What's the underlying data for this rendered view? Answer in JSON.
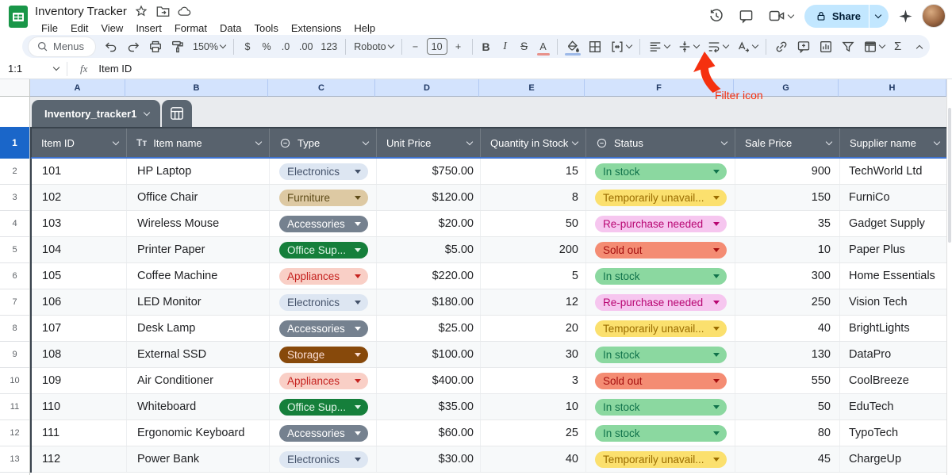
{
  "app": {
    "title": "Inventory Tracker",
    "menus": [
      "File",
      "Edit",
      "View",
      "Insert",
      "Format",
      "Data",
      "Tools",
      "Extensions",
      "Help"
    ],
    "share_label": "Share"
  },
  "toolbar": {
    "menus_label": "Menus",
    "items": [
      {
        "t": "icon",
        "name": "undo"
      },
      {
        "t": "icon",
        "name": "redo"
      },
      {
        "t": "icon",
        "name": "print"
      },
      {
        "t": "icon",
        "name": "paint-format"
      },
      {
        "t": "textchev",
        "name": "zoom",
        "label": "150%"
      },
      {
        "t": "div"
      },
      {
        "t": "text",
        "name": "format-currency",
        "label": "$"
      },
      {
        "t": "text",
        "name": "format-percent",
        "label": "%"
      },
      {
        "t": "text",
        "name": "decrease-decimal",
        "label": ".0"
      },
      {
        "t": "text",
        "name": "increase-decimal",
        "label": ".00"
      },
      {
        "t": "text",
        "name": "number-format",
        "label": "123"
      },
      {
        "t": "div"
      },
      {
        "t": "textchev",
        "name": "font-family",
        "label": "Roboto"
      },
      {
        "t": "div"
      },
      {
        "t": "text",
        "name": "decrease-font-size",
        "label": "−"
      },
      {
        "t": "box",
        "name": "font-size",
        "label": "10"
      },
      {
        "t": "text",
        "name": "increase-font-size",
        "label": "+"
      },
      {
        "t": "div"
      },
      {
        "t": "text",
        "name": "bold",
        "label": "B",
        "cls": "bold"
      },
      {
        "t": "text",
        "name": "italic",
        "label": "I",
        "cls": "ital"
      },
      {
        "t": "text",
        "name": "strikethrough",
        "label": "S",
        "cls": "strike"
      },
      {
        "t": "text",
        "name": "text-color",
        "label": "A",
        "bar": "#e8918a"
      },
      {
        "t": "div"
      },
      {
        "t": "icon",
        "name": "fill-color",
        "bar": "#9db9e8"
      },
      {
        "t": "icon",
        "name": "borders"
      },
      {
        "t": "iconchev",
        "name": "merge-cells"
      },
      {
        "t": "div"
      },
      {
        "t": "iconchev",
        "name": "horizontal-align"
      },
      {
        "t": "iconchev",
        "name": "vertical-align"
      },
      {
        "t": "iconchev",
        "name": "text-wrap"
      },
      {
        "t": "iconchev",
        "name": "text-rotation"
      },
      {
        "t": "div"
      },
      {
        "t": "icon",
        "name": "insert-link"
      },
      {
        "t": "icon",
        "name": "insert-comment"
      },
      {
        "t": "icon",
        "name": "insert-chart"
      },
      {
        "t": "icon",
        "name": "create-filter"
      },
      {
        "t": "iconchev",
        "name": "table-views"
      },
      {
        "t": "text",
        "name": "functions",
        "label": "Σ",
        "cls": "sigma"
      }
    ]
  },
  "formula_bar": {
    "name_box": "1:1",
    "fx_label": "fx",
    "value": "Item ID"
  },
  "columns": [
    "A",
    "B",
    "C",
    "D",
    "E",
    "F",
    "G",
    "H"
  ],
  "sheet_tab": {
    "name": "Inventory_tracker1"
  },
  "table": {
    "headers": [
      {
        "label": "Item ID",
        "icon": null
      },
      {
        "label": "Item name",
        "icon": "text"
      },
      {
        "label": "Type",
        "icon": "chip"
      },
      {
        "label": "Unit Price",
        "icon": null
      },
      {
        "label": "Quantity in Stock",
        "icon": null
      },
      {
        "label": "Status",
        "icon": "chip"
      },
      {
        "label": "Sale Price",
        "icon": null
      },
      {
        "label": "Supplier name",
        "icon": null
      }
    ],
    "rows": [
      {
        "n": "2",
        "id": "101",
        "name": "HP Laptop",
        "type": {
          "label": "Electronics",
          "style": "electronics"
        },
        "unit_price": "$750.00",
        "qty": "15",
        "status": {
          "label": "In stock",
          "style": "instock"
        },
        "sale_price": "900",
        "supplier": "TechWorld Ltd"
      },
      {
        "n": "3",
        "id": "102",
        "name": "Office Chair",
        "type": {
          "label": "Furniture",
          "style": "furniture"
        },
        "unit_price": "$120.00",
        "qty": "8",
        "status": {
          "label": "Temporarily unavail...",
          "style": "unavailable"
        },
        "sale_price": "150",
        "supplier": "FurniCo"
      },
      {
        "n": "4",
        "id": "103",
        "name": "Wireless Mouse",
        "type": {
          "label": "Accessories",
          "style": "accessories"
        },
        "unit_price": "$20.00",
        "qty": "50",
        "status": {
          "label": "Re-purchase needed",
          "style": "repurchase"
        },
        "sale_price": "35",
        "supplier": "Gadget Supply"
      },
      {
        "n": "5",
        "id": "104",
        "name": "Printer Paper",
        "type": {
          "label": "Office Sup...",
          "style": "office"
        },
        "unit_price": "$5.00",
        "qty": "200",
        "status": {
          "label": "Sold out",
          "style": "soldout"
        },
        "sale_price": "10",
        "supplier": "Paper Plus"
      },
      {
        "n": "6",
        "id": "105",
        "name": "Coffee Machine",
        "type": {
          "label": "Appliances",
          "style": "appliances"
        },
        "unit_price": "$220.00",
        "qty": "5",
        "status": {
          "label": "In stock",
          "style": "instock"
        },
        "sale_price": "300",
        "supplier": "Home Essentials"
      },
      {
        "n": "7",
        "id": "106",
        "name": "LED Monitor",
        "type": {
          "label": "Electronics",
          "style": "electronics"
        },
        "unit_price": "$180.00",
        "qty": "12",
        "status": {
          "label": "Re-purchase needed",
          "style": "repurchase"
        },
        "sale_price": "250",
        "supplier": "Vision Tech"
      },
      {
        "n": "8",
        "id": "107",
        "name": "Desk Lamp",
        "type": {
          "label": "Accessories",
          "style": "accessories"
        },
        "unit_price": "$25.00",
        "qty": "20",
        "status": {
          "label": "Temporarily unavail...",
          "style": "unavailable"
        },
        "sale_price": "40",
        "supplier": "BrightLights"
      },
      {
        "n": "9",
        "id": "108",
        "name": "External SSD",
        "type": {
          "label": "Storage",
          "style": "storage"
        },
        "unit_price": "$100.00",
        "qty": "30",
        "status": {
          "label": "In stock",
          "style": "instock"
        },
        "sale_price": "130",
        "supplier": "DataPro"
      },
      {
        "n": "10",
        "id": "109",
        "name": "Air Conditioner",
        "type": {
          "label": "Appliances",
          "style": "appliances"
        },
        "unit_price": "$400.00",
        "qty": "3",
        "status": {
          "label": "Sold out",
          "style": "soldout"
        },
        "sale_price": "550",
        "supplier": "CoolBreeze"
      },
      {
        "n": "11",
        "id": "110",
        "name": "Whiteboard",
        "type": {
          "label": "Office Sup...",
          "style": "office"
        },
        "unit_price": "$35.00",
        "qty": "10",
        "status": {
          "label": "In stock",
          "style": "instock"
        },
        "sale_price": "50",
        "supplier": "EduTech"
      },
      {
        "n": "12",
        "id": "111",
        "name": "Ergonomic Keyboard",
        "type": {
          "label": "Accessories",
          "style": "accessories"
        },
        "unit_price": "$60.00",
        "qty": "25",
        "status": {
          "label": "In stock",
          "style": "instock"
        },
        "sale_price": "80",
        "supplier": "TypoTech"
      },
      {
        "n": "13",
        "id": "112",
        "name": "Power Bank",
        "type": {
          "label": "Electronics",
          "style": "electronics"
        },
        "unit_price": "$30.00",
        "qty": "40",
        "status": {
          "label": "Temporarily unavail...",
          "style": "unavailable"
        },
        "sale_price": "45",
        "supplier": "ChargeUp"
      }
    ]
  },
  "chip_colors": {
    "electronics": {
      "bg": "#dde6f2",
      "fg": "#44526a"
    },
    "furniture": {
      "bg": "#ddc9a3",
      "fg": "#5e4b18"
    },
    "accessories": {
      "bg": "#75818f",
      "fg": "#ffffff"
    },
    "office": {
      "bg": "#157f3b",
      "fg": "#e2f6e9"
    },
    "appliances": {
      "bg": "#f9cfc6",
      "fg": "#c5221f"
    },
    "storage": {
      "bg": "#87490b",
      "fg": "#fbdcd3"
    },
    "instock": {
      "bg": "#8bd8a0",
      "fg": "#11734b"
    },
    "unavailable": {
      "bg": "#fbe06e",
      "fg": "#9a6c00"
    },
    "repurchase": {
      "bg": "#f6c6ef",
      "fg": "#b80672"
    },
    "soldout": {
      "bg": "#f48c73",
      "fg": "#a50e0e"
    }
  },
  "annotation": {
    "label": "Filter icon",
    "color": "#f5300f"
  },
  "colors": {
    "selected_header_bg": "#d3e3fd",
    "table_header_bg": "#58626d",
    "selected_row_number_bg": "#1a66c9",
    "share_button_bg": "#c2e7ff"
  }
}
